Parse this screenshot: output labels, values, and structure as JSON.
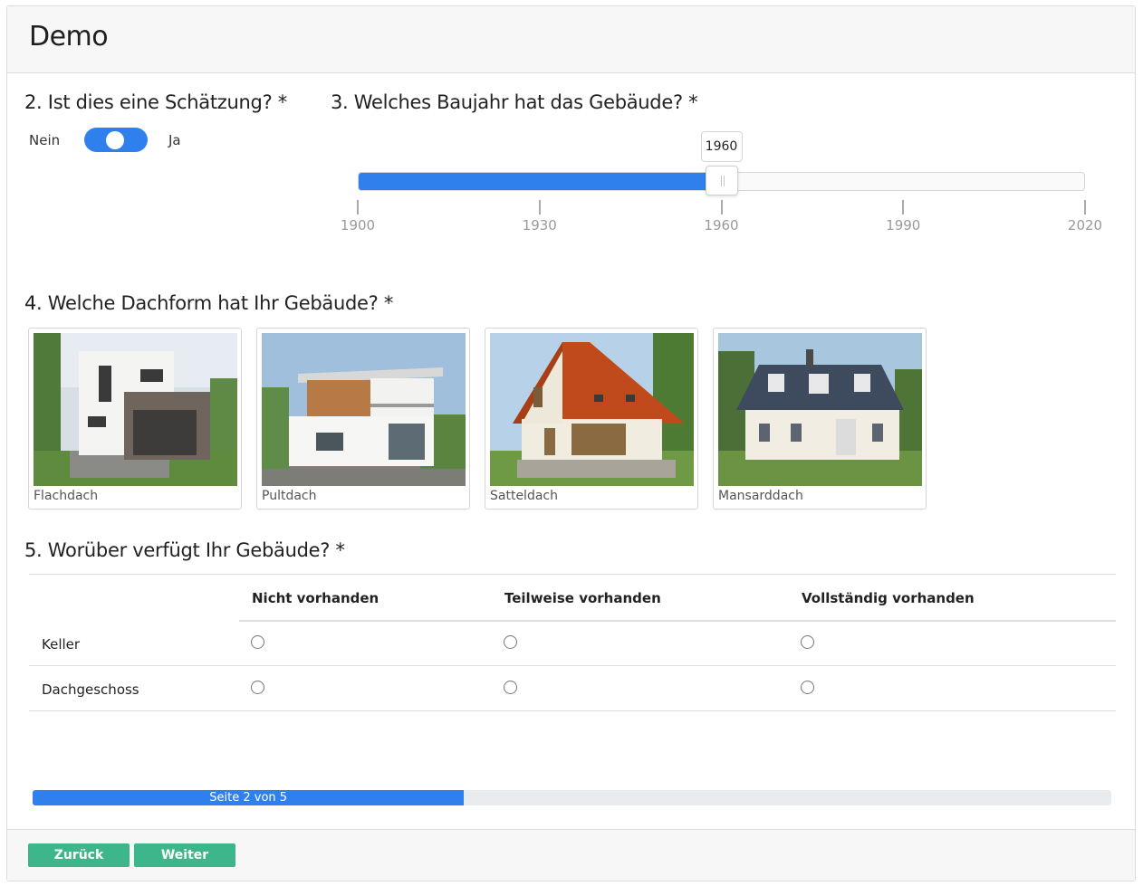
{
  "survey": {
    "title": "Demo"
  },
  "q2": {
    "title": "2. Ist dies eine Schätzung? *",
    "off_label": "Nein",
    "on_label": "Ja",
    "value": true
  },
  "q3": {
    "title": "3. Welches Baujahr hat das Gebäude? *",
    "min": 1900,
    "max": 2020,
    "value": 1960,
    "value_label": "1960",
    "ticks": [
      "1900",
      "1930",
      "1960",
      "1990",
      "2020"
    ]
  },
  "q4": {
    "title": "4. Welche Dachform hat Ihr Gebäude? *",
    "options": [
      {
        "label": "Flachdach"
      },
      {
        "label": "Pultdach"
      },
      {
        "label": "Satteldach"
      },
      {
        "label": "Mansarddach"
      }
    ]
  },
  "q5": {
    "title": "5. Worüber verfügt Ihr Gebäude? *",
    "columns": [
      "Nicht vorhanden",
      "Teilweise vorhanden",
      "Vollständig vorhanden"
    ],
    "rows": [
      "Keller",
      "Dachgeschoss"
    ]
  },
  "progress": {
    "label": "Seite 2 von 5",
    "current": 2,
    "total": 5
  },
  "nav": {
    "back_label": "Zurück",
    "next_label": "Weiter"
  },
  "colors": {
    "accent": "#2f80ed",
    "button": "#3eb68b"
  }
}
